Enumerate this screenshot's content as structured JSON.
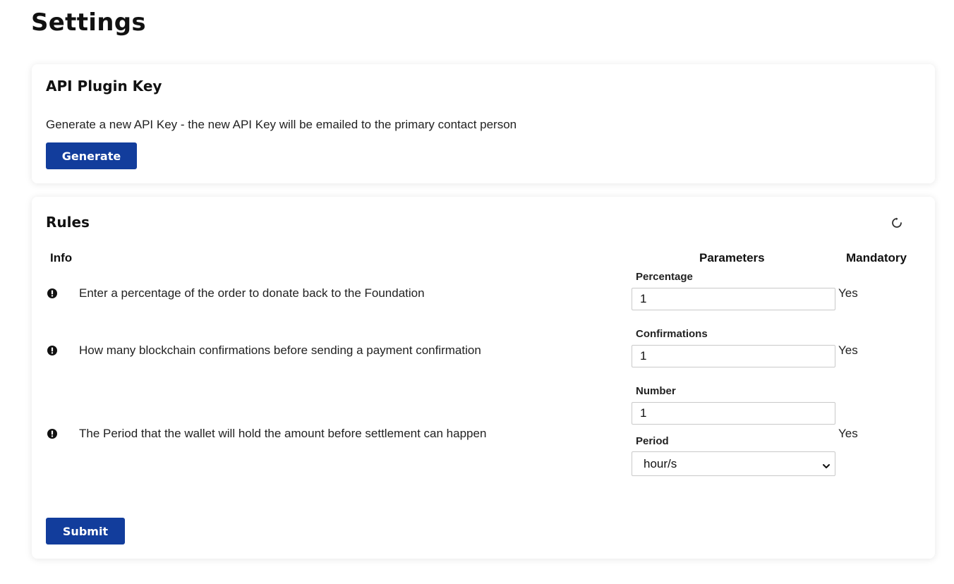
{
  "page": {
    "title": "Settings"
  },
  "api_card": {
    "title": "API Plugin Key",
    "description": "Generate a new API Key - the new API Key will be emailed to the primary contact person",
    "generate_label": "Generate"
  },
  "rules_card": {
    "title": "Rules",
    "refresh_icon": "refresh-icon",
    "columns": {
      "info": "Info",
      "parameters": "Parameters",
      "mandatory": "Mandatory"
    },
    "rules": [
      {
        "icon": "alert-icon",
        "text": "Enter a percentage of the order to donate back to the Foundation",
        "param_label": "Percentage",
        "param_value": "1",
        "mandatory": "Yes"
      },
      {
        "icon": "alert-icon",
        "text": "How many blockchain confirmations before sending a payment confirmation",
        "param_label": "Confirmations",
        "param_value": "1",
        "mandatory": "Yes"
      },
      {
        "icon": "alert-icon",
        "text": "The Period that the wallet will hold the amount before settlement can happen",
        "param_label": "Number",
        "param_value": "1",
        "period_label": "Period",
        "period_value": "hour/s",
        "mandatory": "Yes"
      }
    ],
    "submit_label": "Submit"
  },
  "colors": {
    "primary_button": "#123d9c",
    "page_bg": "#ffffff"
  }
}
